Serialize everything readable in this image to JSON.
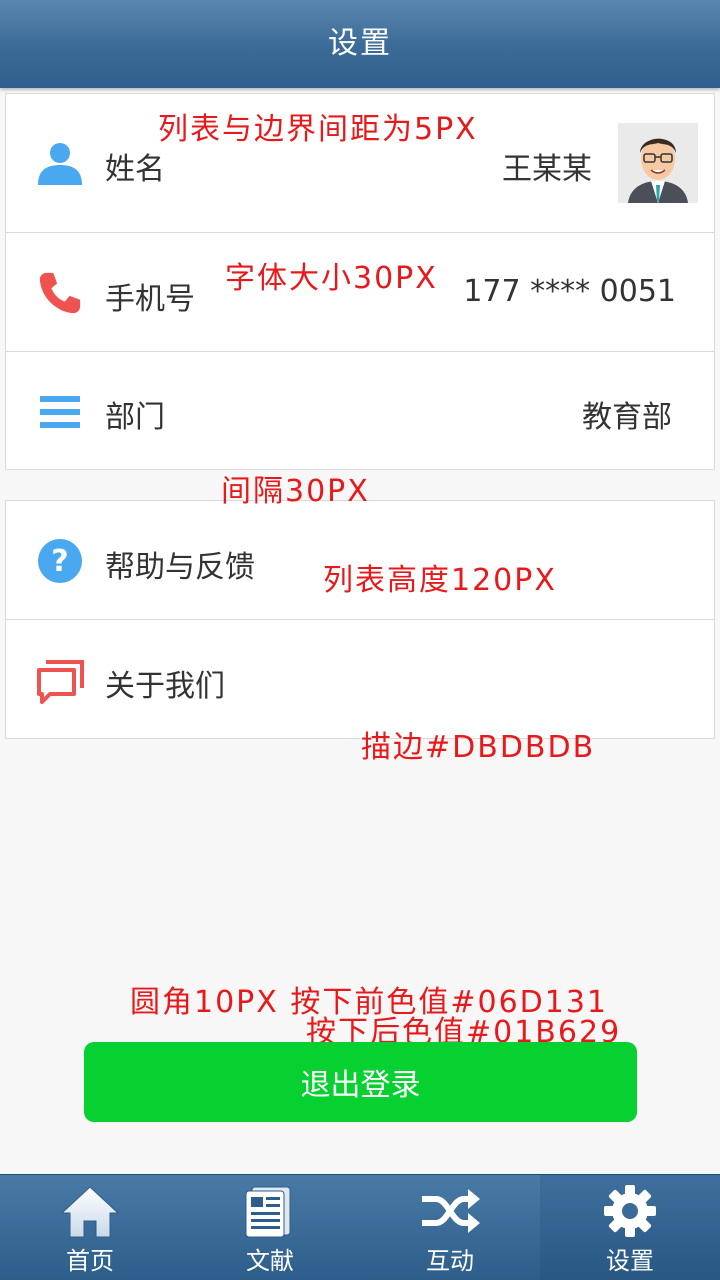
{
  "header": {
    "title": "设置"
  },
  "profile": {
    "name": {
      "label": "姓名",
      "value": "王某某"
    },
    "phone": {
      "label": "手机号",
      "value": "177 **** 0051"
    },
    "dept": {
      "label": "部门",
      "value": "教育部"
    }
  },
  "misc": {
    "help": {
      "label": "帮助与反馈"
    },
    "about": {
      "label": "关于我们"
    }
  },
  "annotations": {
    "margin": "列表与边界间距为5PX",
    "font": "字体大小30PX",
    "gap": "间隔30PX",
    "height": "列表高度120PX",
    "border": "描边#DBDBDB",
    "button_line1": "圆角10PX 按下前色值#06D131",
    "button_line2": "按下后色值#01B629"
  },
  "logout": {
    "label": "退出登录"
  },
  "tabs": [
    {
      "label": "首页",
      "icon": "home-icon"
    },
    {
      "label": "文献",
      "icon": "document-icon"
    },
    {
      "label": "互动",
      "icon": "shuffle-icon"
    },
    {
      "label": "设置",
      "icon": "gear-icon",
      "active": true
    }
  ],
  "colors": {
    "accent": "#3d6c98",
    "icon_blue": "#4aa8f0",
    "icon_red": "#ef5350",
    "border": "#dbdbdb",
    "button": "#06d131",
    "button_pressed": "#01b629",
    "annotation": "#e8191a"
  }
}
